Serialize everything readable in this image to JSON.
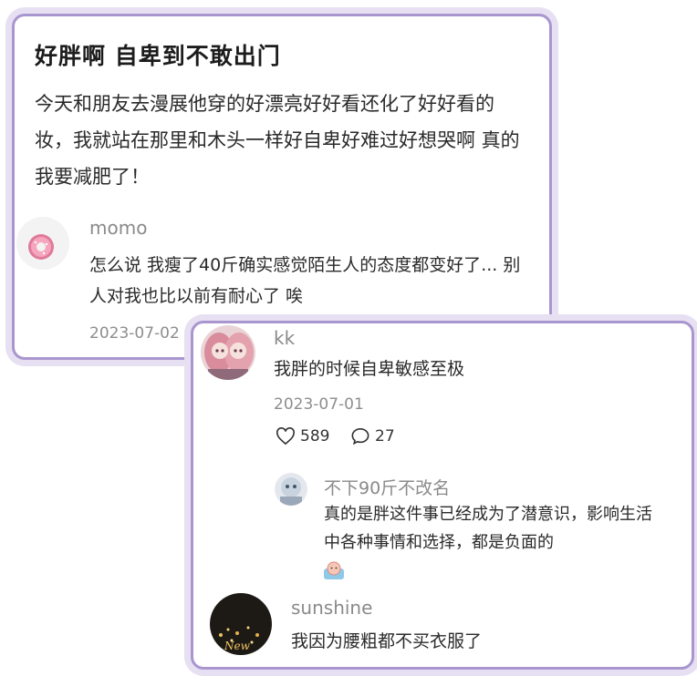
{
  "post": {
    "title": "好胖啊 自卑到不敢出门",
    "body": "今天和朋友去漫展他穿的好漂亮好好看还化了好好看的妆，我就站在那里和木头一样好自卑好难过好想哭啊 真的我要减肥了！"
  },
  "comments": [
    {
      "user": "momo",
      "text": "怎么说 我瘦了40斤确实感觉陌生人的态度都变好了... 别人对我也比以前有耐心了 唉",
      "date": "2023-07-02"
    },
    {
      "user": "kk",
      "text": "我胖的时候自卑敏感至极",
      "date": "2023-07-01",
      "likes": "589",
      "replies_count": "27",
      "reply": {
        "user": "不下90斤不改名",
        "text": "真的是胖这件事已经成为了潜意识，影响生活中各种事情和选择，都是负面的"
      }
    },
    {
      "user": "sunshine",
      "text": "我因为腰粗都不买衣服了",
      "avatar_text": "New"
    }
  ],
  "icons": {
    "like": "heart-outline-icon",
    "reply": "speech-bubble-icon",
    "reply_emoji": "cute-face-emoji-icon"
  },
  "colors": {
    "card_border": "#a996cf",
    "card_glow": "#e6e0f2"
  }
}
